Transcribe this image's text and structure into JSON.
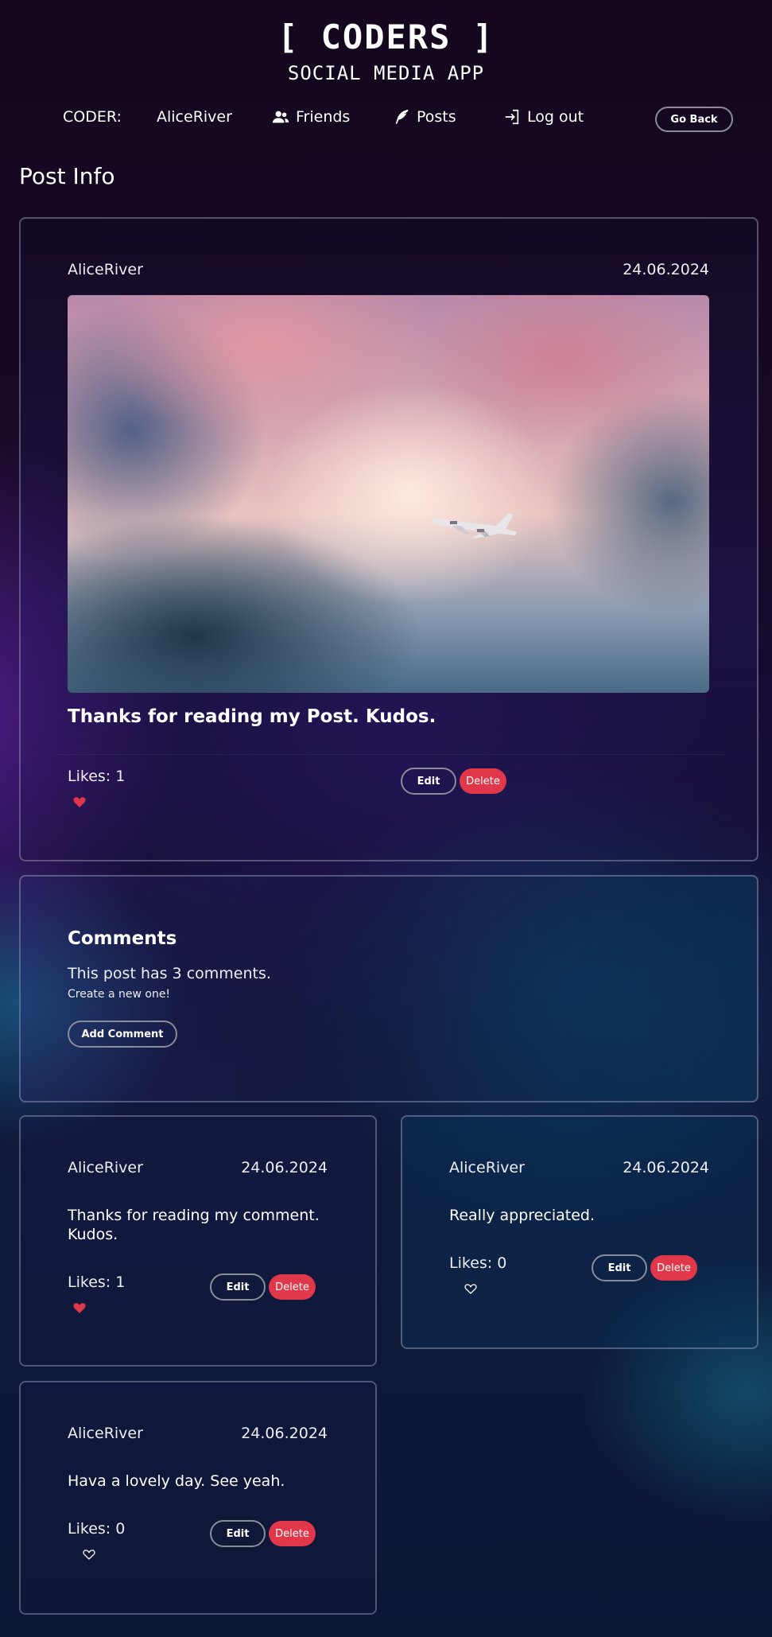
{
  "header": {
    "title": "[ CODERS ]",
    "subtitle": "SOCIAL MEDIA APP"
  },
  "nav": {
    "coder_label": "CODER:",
    "username": "AliceRiver",
    "friends": "Friends",
    "posts": "Posts",
    "logout": "Log out",
    "friends_icon": "users-icon",
    "posts_icon": "feather-icon",
    "logout_icon": "sign-in-icon"
  },
  "go_back_label": "Go Back",
  "page_title": "Post Info",
  "post": {
    "author": "AliceRiver",
    "date": "24.06.2024",
    "image_alt": "airplane-in-cloudy-sky",
    "text": "Thanks for reading my Post. Kudos.",
    "likes_label": "Likes: 1",
    "liked": true,
    "edit_label": "Edit",
    "delete_label": "Delete"
  },
  "comments_section": {
    "title": "Comments",
    "count_text": "This post has 3 comments.",
    "cta_text": "Create a new one!",
    "add_label": "Add Comment"
  },
  "comments": [
    {
      "author": "AliceRiver",
      "date": "24.06.2024",
      "text_line1": "Thanks for reading my comment.",
      "text_line2": "Kudos.",
      "likes_label": "Likes: 1",
      "liked": true,
      "edit_label": "Edit",
      "delete_label": "Delete"
    },
    {
      "author": "AliceRiver",
      "date": "24.06.2024",
      "text_line1": "Really appreciated.",
      "likes_label": "Likes: 0",
      "liked": false,
      "edit_label": "Edit",
      "delete_label": "Delete"
    },
    {
      "author": "AliceRiver",
      "date": "24.06.2024",
      "text_line1": "Hava a lovely day. See yeah.",
      "likes_label": "Likes: 0",
      "liked": false,
      "edit_label": "Edit",
      "delete_label": "Delete"
    }
  ],
  "colors": {
    "accent_delete": "#e0384a",
    "heart": "#e0384a"
  }
}
